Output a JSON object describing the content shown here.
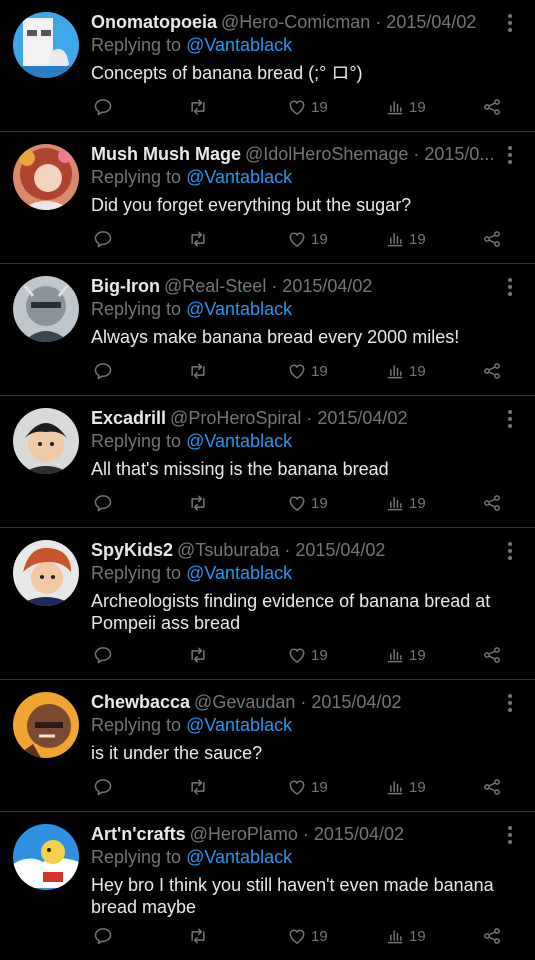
{
  "replying_prefix": "Replying to",
  "colors": {
    "background": "#000000",
    "accent": "#1d9bf0",
    "muted": "#71767b",
    "text": "#e7e9ea",
    "divider": "#2f3336"
  },
  "action_icons": [
    "reply-icon",
    "retweet-icon",
    "like-icon",
    "views-icon",
    "share-icon"
  ],
  "tweets": [
    {
      "name": "Onomatopoeia",
      "meta": "@Hero-Comicman · 2015/04/02",
      "replying_to": "@Vantablack",
      "text": "Concepts of banana bread (;° ロ°)",
      "likes": "19",
      "views": "19"
    },
    {
      "name": "Mush Mush Mage",
      "meta": "@IdolHeroShemage · 2015/0...",
      "replying_to": "@Vantablack",
      "text": "Did you forget everything but the sugar?",
      "likes": "19",
      "views": "19"
    },
    {
      "name": "Big-Iron",
      "meta": "@Real-Steel · 2015/04/02",
      "replying_to": "@Vantablack",
      "text": "Always make banana bread every 2000 miles!",
      "likes": "19",
      "views": "19"
    },
    {
      "name": "Excadrill",
      "meta": "@ProHeroSpiral · 2015/04/02",
      "replying_to": "@Vantablack",
      "text": "All that's missing is the banana bread",
      "likes": "19",
      "views": "19"
    },
    {
      "name": "SpyKids2",
      "meta": "@Tsuburaba · 2015/04/02",
      "replying_to": "@Vantablack",
      "text": "Archeologists finding evidence of banana bread at Pompeii ass bread",
      "likes": "19",
      "views": "19"
    },
    {
      "name": "Chewbacca",
      "meta": "@Gevaudan · 2015/04/02",
      "replying_to": "@Vantablack",
      "text": "is it under the sauce?",
      "likes": "19",
      "views": "19"
    },
    {
      "name": "Art'n'crafts",
      "meta": "@HeroPlamo · 2015/04/02",
      "replying_to": "@Vantablack",
      "text": "Hey bro I think you still haven't even made banana bread maybe",
      "likes": "19",
      "views": "19"
    }
  ]
}
